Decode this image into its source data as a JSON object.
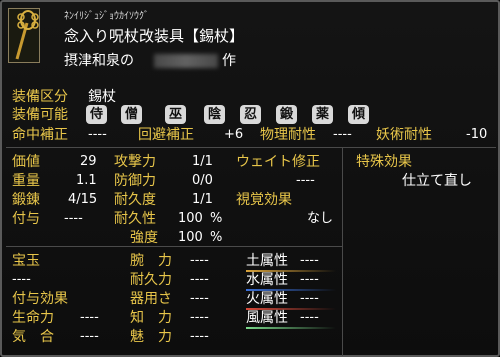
{
  "header": {
    "furigana": "ﾈﾝｲﾘｼﾞｭｼﾞｮｳｶｲｿｳｸﾞ",
    "name": "念入り呪杖改装具【錫杖】",
    "maker_prefix": "摂津和泉の",
    "maker_suffix": "作",
    "icon": "staff-ornament-icon"
  },
  "equip": {
    "category_label": "装備区分",
    "category_value": "錫杖",
    "possible_label": "装備可能",
    "classes": [
      "侍",
      "僧",
      "巫",
      "陰",
      "忍",
      "鍛",
      "薬",
      "傾"
    ]
  },
  "modifiers": [
    {
      "label": "命中補正",
      "value": "----"
    },
    {
      "label": "回避補正",
      "value": "+6"
    },
    {
      "label": "物理耐性",
      "value": "----"
    },
    {
      "label": "妖術耐性",
      "value": "-10"
    }
  ],
  "stats_left": [
    {
      "label": "価値",
      "value": "29"
    },
    {
      "label": "重量",
      "value": "1.1"
    },
    {
      "label": "鍛錬",
      "value": "4/15"
    },
    {
      "label": "付与",
      "value": "----"
    }
  ],
  "stats_mid": [
    {
      "label": "攻撃力",
      "value": "1/1"
    },
    {
      "label": "防御力",
      "value": "0/0"
    },
    {
      "label": "耐久度",
      "value": "1/1"
    },
    {
      "label": "耐久性",
      "value": "100",
      "unit": "%"
    },
    {
      "label": "強度",
      "value": "100",
      "unit": "%"
    }
  ],
  "weight_fix": {
    "label": "ウェイト修正",
    "value": "----"
  },
  "visual": {
    "label": "視覚効果",
    "value": "なし"
  },
  "special": {
    "label": "特殊効果",
    "value": "仕立て直し"
  },
  "lower": {
    "gem_label": "宝玉",
    "gem_value": "----",
    "enchant_label": "付与効果",
    "stats": [
      {
        "label": "生命力",
        "value": "----"
      },
      {
        "label": "気　合",
        "value": "----"
      }
    ],
    "mid_stats": [
      {
        "label": "腕　力",
        "value": "----"
      },
      {
        "label": "耐久力",
        "value": "----"
      },
      {
        "label": "器用さ",
        "value": "----"
      },
      {
        "label": "知　力",
        "value": "----"
      },
      {
        "label": "魅　力",
        "value": "----"
      }
    ],
    "attributes": [
      {
        "label": "土属性",
        "value": "----",
        "color": "#d8a23a"
      },
      {
        "label": "水属性",
        "value": "----",
        "color": "#3a6fd8"
      },
      {
        "label": "火属性",
        "value": "----",
        "color": "#d84a3a"
      },
      {
        "label": "風属性",
        "value": "----",
        "color": "#7ad88a"
      }
    ]
  }
}
